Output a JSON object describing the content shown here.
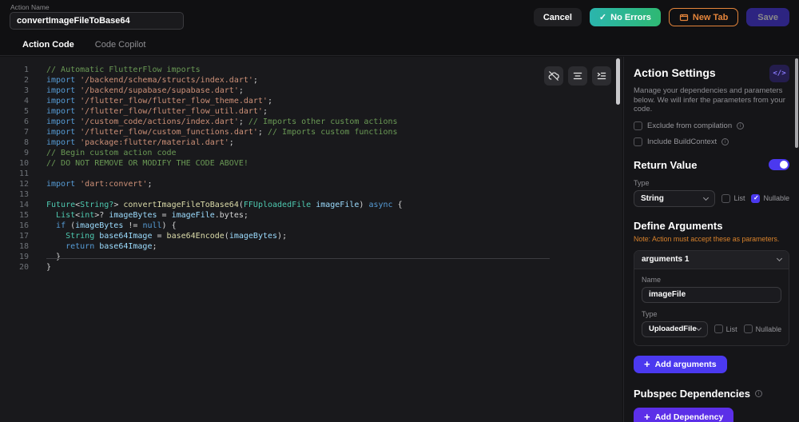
{
  "header": {
    "action_name_label": "Action Name",
    "action_name_value": "convertImageFileToBase64",
    "cancel_label": "Cancel",
    "no_errors_label": "No Errors",
    "new_tab_label": "New Tab",
    "save_label": "Save"
  },
  "tabs": [
    {
      "label": "Action Code",
      "active": true
    },
    {
      "label": "Code Copilot",
      "active": false
    }
  ],
  "editor": {
    "lines": [
      [
        {
          "t": "// Automatic FlutterFlow imports",
          "c": "com"
        }
      ],
      [
        {
          "t": "import",
          "c": "kw"
        },
        {
          "t": " ",
          "c": "plain"
        },
        {
          "t": "'/backend/schema/structs/index.dart'",
          "c": "str"
        },
        {
          "t": ";",
          "c": "plain"
        }
      ],
      [
        {
          "t": "import",
          "c": "kw"
        },
        {
          "t": " ",
          "c": "plain"
        },
        {
          "t": "'/backend/supabase/supabase.dart'",
          "c": "str"
        },
        {
          "t": ";",
          "c": "plain"
        }
      ],
      [
        {
          "t": "import",
          "c": "kw"
        },
        {
          "t": " ",
          "c": "plain"
        },
        {
          "t": "'/flutter_flow/flutter_flow_theme.dart'",
          "c": "str"
        },
        {
          "t": ";",
          "c": "plain"
        }
      ],
      [
        {
          "t": "import",
          "c": "kw"
        },
        {
          "t": " ",
          "c": "plain"
        },
        {
          "t": "'/flutter_flow/flutter_flow_util.dart'",
          "c": "str"
        },
        {
          "t": ";",
          "c": "plain"
        }
      ],
      [
        {
          "t": "import",
          "c": "kw"
        },
        {
          "t": " ",
          "c": "plain"
        },
        {
          "t": "'/custom_code/actions/index.dart'",
          "c": "str"
        },
        {
          "t": "; ",
          "c": "plain"
        },
        {
          "t": "// Imports other custom actions",
          "c": "com"
        }
      ],
      [
        {
          "t": "import",
          "c": "kw"
        },
        {
          "t": " ",
          "c": "plain"
        },
        {
          "t": "'/flutter_flow/custom_functions.dart'",
          "c": "str"
        },
        {
          "t": "; ",
          "c": "plain"
        },
        {
          "t": "// Imports custom functions",
          "c": "com"
        }
      ],
      [
        {
          "t": "import",
          "c": "kw"
        },
        {
          "t": " ",
          "c": "plain"
        },
        {
          "t": "'package:flutter/material.dart'",
          "c": "str"
        },
        {
          "t": ";",
          "c": "plain"
        }
      ],
      [
        {
          "t": "// Begin custom action code",
          "c": "com"
        }
      ],
      [
        {
          "t": "// DO NOT REMOVE OR MODIFY THE CODE ABOVE!",
          "c": "com"
        }
      ],
      [],
      [
        {
          "t": "import",
          "c": "kw"
        },
        {
          "t": " ",
          "c": "plain"
        },
        {
          "t": "'dart:convert'",
          "c": "str"
        },
        {
          "t": ";",
          "c": "plain"
        }
      ],
      [],
      [
        {
          "t": "Future",
          "c": "type"
        },
        {
          "t": "<",
          "c": "plain"
        },
        {
          "t": "String?",
          "c": "type"
        },
        {
          "t": "> ",
          "c": "plain"
        },
        {
          "t": "convertImageFileToBase64",
          "c": "fn"
        },
        {
          "t": "(",
          "c": "plain"
        },
        {
          "t": "FFUploadedFile",
          "c": "type"
        },
        {
          "t": " imageFile",
          "c": "var"
        },
        {
          "t": ") ",
          "c": "plain"
        },
        {
          "t": "async",
          "c": "kw"
        },
        {
          "t": " {",
          "c": "plain"
        }
      ],
      [
        {
          "t": "  ",
          "c": "plain"
        },
        {
          "t": "List",
          "c": "type"
        },
        {
          "t": "<",
          "c": "plain"
        },
        {
          "t": "int",
          "c": "type"
        },
        {
          "t": ">? ",
          "c": "plain"
        },
        {
          "t": "imageBytes",
          "c": "var"
        },
        {
          "t": " = ",
          "c": "plain"
        },
        {
          "t": "imageFile",
          "c": "var"
        },
        {
          "t": ".bytes;",
          "c": "plain"
        }
      ],
      [
        {
          "t": "  ",
          "c": "plain"
        },
        {
          "t": "if",
          "c": "kw"
        },
        {
          "t": " (",
          "c": "plain"
        },
        {
          "t": "imageBytes",
          "c": "var"
        },
        {
          "t": " != ",
          "c": "plain"
        },
        {
          "t": "null",
          "c": "kw"
        },
        {
          "t": ") {",
          "c": "plain"
        }
      ],
      [
        {
          "t": "    ",
          "c": "plain"
        },
        {
          "t": "String",
          "c": "type"
        },
        {
          "t": " ",
          "c": "plain"
        },
        {
          "t": "base64Image",
          "c": "var"
        },
        {
          "t": " = ",
          "c": "plain"
        },
        {
          "t": "base64Encode",
          "c": "fn"
        },
        {
          "t": "(",
          "c": "plain"
        },
        {
          "t": "imageBytes",
          "c": "var"
        },
        {
          "t": ");",
          "c": "plain"
        }
      ],
      [
        {
          "t": "    ",
          "c": "plain"
        },
        {
          "t": "return",
          "c": "kw"
        },
        {
          "t": " ",
          "c": "plain"
        },
        {
          "t": "base64Image",
          "c": "var"
        },
        {
          "t": ";",
          "c": "plain"
        }
      ],
      [
        {
          "t": "  }",
          "c": "plain"
        }
      ],
      [
        {
          "t": "}",
          "c": "plain"
        }
      ]
    ]
  },
  "settings": {
    "title": "Action Settings",
    "description": "Manage your dependencies and parameters below. We will infer the parameters from your code.",
    "exclude_label": "Exclude from compilation",
    "exclude_checked": false,
    "build_context_label": "Include BuildContext",
    "build_context_checked": false,
    "return_value": {
      "title": "Return Value",
      "toggle_on": true,
      "type_label": "Type",
      "type_value": "String",
      "list_label": "List",
      "list_checked": false,
      "nullable_label": "Nullable",
      "nullable_checked": true
    },
    "arguments": {
      "title": "Define Arguments",
      "note": "Note: Action must accept these as parameters.",
      "items": [
        {
          "header": "arguments 1",
          "name_label": "Name",
          "name_value": "imageFile",
          "type_label": "Type",
          "type_value": "UploadedFile",
          "list_label": "List",
          "list_checked": false,
          "nullable_label": "Nullable",
          "nullable_checked": false
        }
      ],
      "add_label": "Add arguments"
    },
    "pubspec": {
      "title": "Pubspec Dependencies",
      "add_label": "Add Dependency"
    }
  },
  "colors": {
    "accent_purple": "#4b39ef",
    "success_teal": "#2bb39b",
    "warning_orange": "#e5853b",
    "note_orange": "#d9822b"
  }
}
